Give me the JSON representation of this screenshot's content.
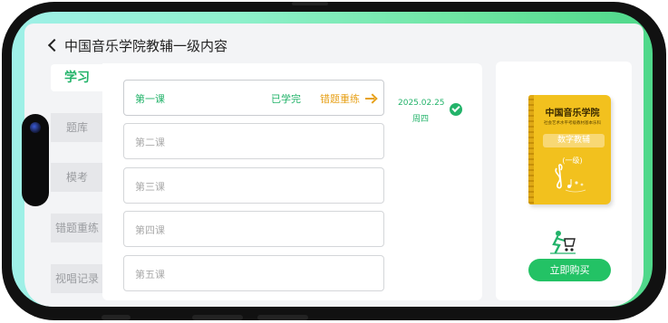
{
  "header": {
    "title": "中国音乐学院教辅一级内容"
  },
  "sidebar": {
    "active": "学习",
    "items": [
      "题库",
      "模考",
      "错题重练",
      "视唱记录"
    ]
  },
  "lessons": [
    {
      "title": "第一课",
      "status": "已学完",
      "review": "错题重练",
      "date": "2025.02.25",
      "weekday": "周四"
    },
    {
      "title": "第二课"
    },
    {
      "title": "第三课"
    },
    {
      "title": "第四课"
    },
    {
      "title": "第五课"
    }
  ],
  "product": {
    "book_title": "中国音乐学院",
    "book_subtitle": "社会艺术水平考级教材基本乐科",
    "book_badge": "数字教辅",
    "book_level": "(一级)",
    "buy_label": "立即购买"
  },
  "icons": {
    "back": "back-chevron-icon",
    "arrow": "right-arrow-icon",
    "check": "check-circle-icon",
    "clef": "treble-clef-icon",
    "buyer": "shopping-person-icon"
  },
  "colors": {
    "accent": "#23b36a",
    "review": "#e7a11a",
    "book": "#f2c11e",
    "buy_button": "#23c265"
  }
}
